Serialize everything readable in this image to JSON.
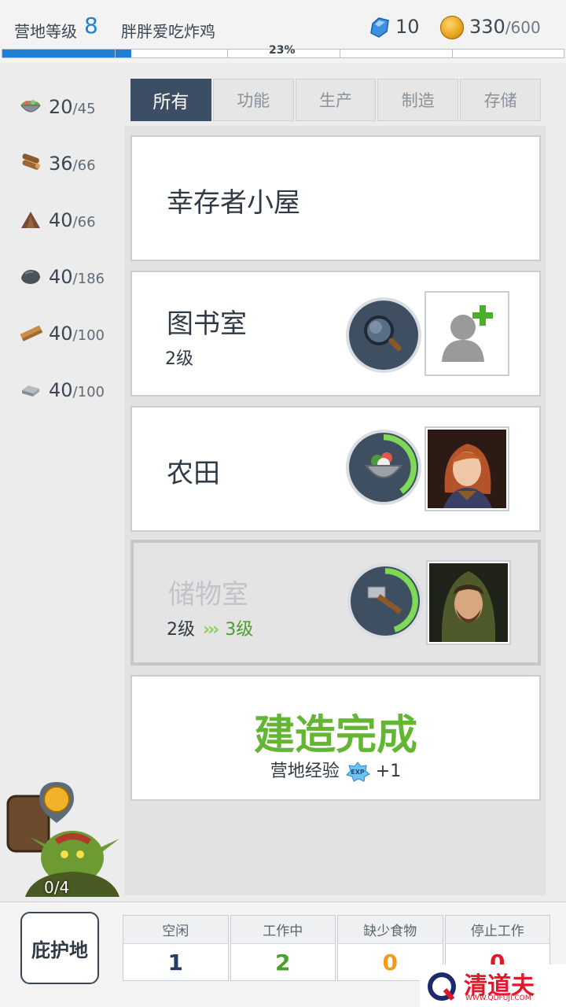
{
  "header": {
    "camp_label": "营地等级",
    "camp_level": "8",
    "player_name": "胖胖爱吃炸鸡",
    "gems": "10",
    "coins": "330",
    "coins_max": "/600",
    "progress_text": "23%",
    "progress_value": 0.23
  },
  "resources": [
    {
      "icon": "salad-bowl-icon",
      "value": "20",
      "max": "/45"
    },
    {
      "icon": "wood-logs-icon",
      "value": "36",
      "max": "/66"
    },
    {
      "icon": "dirt-pile-icon",
      "value": "40",
      "max": "/66"
    },
    {
      "icon": "stone-icon",
      "value": "40",
      "max": "/186"
    },
    {
      "icon": "plank-icon",
      "value": "40",
      "max": "/100"
    },
    {
      "icon": "metal-ingot-icon",
      "value": "40",
      "max": "/100"
    }
  ],
  "tabs": [
    {
      "label": "所有",
      "active": true
    },
    {
      "label": "功能"
    },
    {
      "label": "生产"
    },
    {
      "label": "制造"
    },
    {
      "label": "存储"
    }
  ],
  "buildings": [
    {
      "name": "幸存者小屋"
    },
    {
      "name": "图书室",
      "level": "2级",
      "slot_icon": "magnifier-icon",
      "worker": "add-worker-icon"
    },
    {
      "name": "农田",
      "slot_icon": "food-bowl-icon",
      "worker": "female-survivor-portrait"
    },
    {
      "name": "储物室",
      "level_from": "2级",
      "arrows": "›››",
      "level_to": "3级",
      "slot_icon": "hammer-icon",
      "worker": "hooded-survivor-portrait"
    }
  ],
  "build_complete": {
    "title": "建造完成",
    "sub_label": "营地经验",
    "exp_badge": "EXP",
    "exp_gain": "+1"
  },
  "goblin": {
    "count": "0/4"
  },
  "bottom": {
    "shelter_label": "庇护地",
    "stats": [
      {
        "label": "空闲",
        "value": "1",
        "color": "#1f3f66"
      },
      {
        "label": "工作中",
        "value": "2",
        "color": "#49a12b"
      },
      {
        "label": "缺少食物",
        "value": "0",
        "color": "#f29a1a"
      },
      {
        "label": "停止工作",
        "value": "0",
        "color": "#e5162a"
      }
    ]
  },
  "watermark": {
    "text": "清道夫",
    "url": "WWW.QDFUJI.COM"
  }
}
